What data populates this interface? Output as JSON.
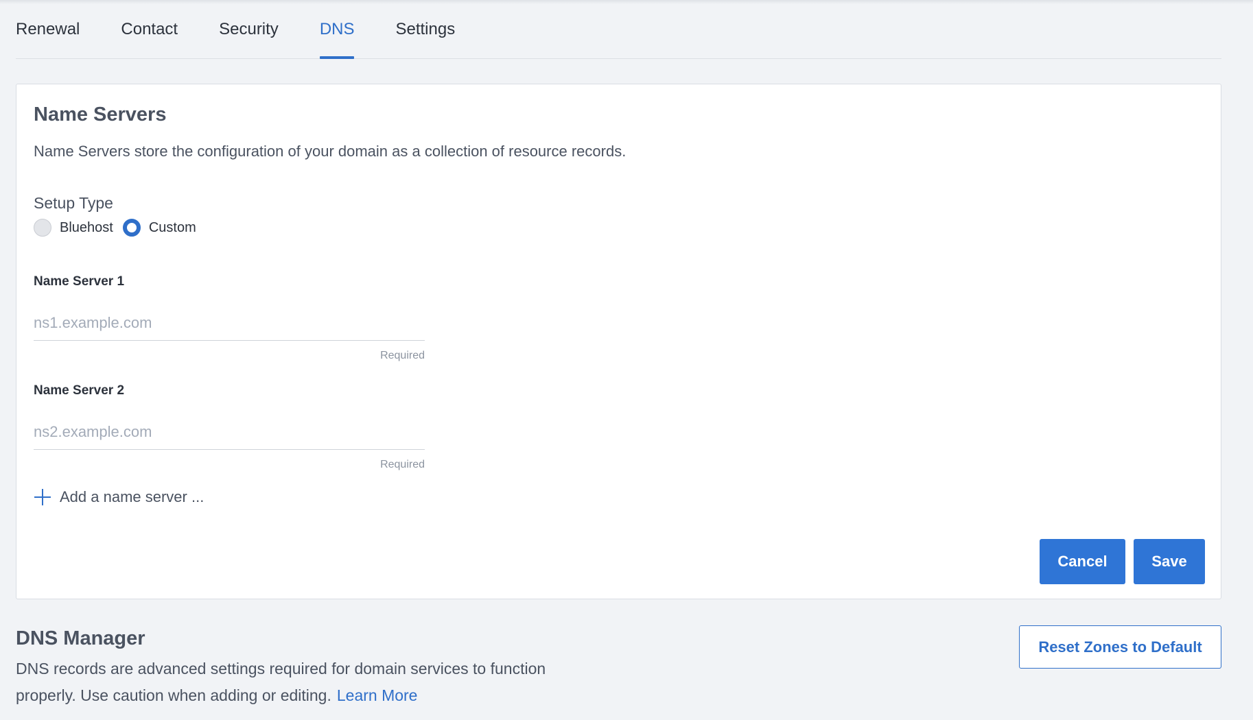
{
  "tabs": [
    {
      "label": "Renewal",
      "active": false
    },
    {
      "label": "Contact",
      "active": false
    },
    {
      "label": "Security",
      "active": false
    },
    {
      "label": "DNS",
      "active": true
    },
    {
      "label": "Settings",
      "active": false
    }
  ],
  "name_servers": {
    "title": "Name Servers",
    "description": "Name Servers store the configuration of your domain as a collection of resource records.",
    "setup_type_label": "Setup Type",
    "setup_options": [
      {
        "label": "Bluehost",
        "selected": false
      },
      {
        "label": "Custom",
        "selected": true
      }
    ],
    "fields": [
      {
        "label": "Name Server 1",
        "value": "",
        "placeholder": "ns1.example.com",
        "hint": "Required"
      },
      {
        "label": "Name Server 2",
        "value": "",
        "placeholder": "ns2.example.com",
        "hint": "Required"
      }
    ],
    "add_label": "Add a name server ...",
    "cancel_label": "Cancel",
    "save_label": "Save"
  },
  "dns_manager": {
    "title": "DNS Manager",
    "description": "DNS records are advanced settings required for domain services to function properly. Use caution when adding or editing.",
    "learn_more": "Learn More",
    "reset_label": "Reset Zones to Default"
  },
  "colors": {
    "accent": "#2f6fc9",
    "button": "#2f75d6",
    "background": "#f1f3f6"
  }
}
